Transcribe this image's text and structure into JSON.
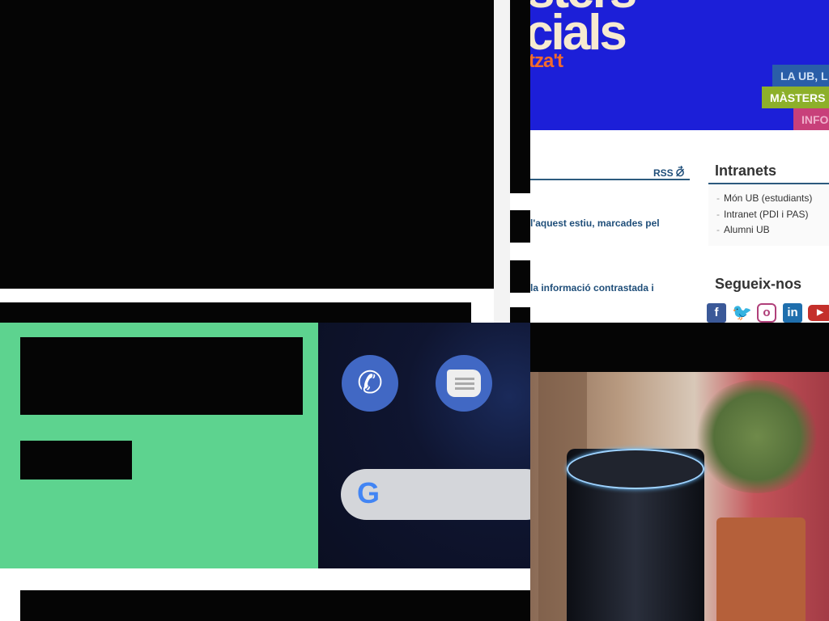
{
  "banner": {
    "title_line": "cials",
    "tagline": "tza't",
    "tabs": [
      {
        "label": "LA UB, L",
        "color": "#2a5ea8"
      },
      {
        "label": "MÀSTERS",
        "color": "#8db02a"
      },
      {
        "label": "INFO",
        "color": "#c8407a"
      }
    ]
  },
  "news": {
    "rss_label": "RSS",
    "items": [
      "l'aquest estiu, marcades pel",
      "la informació contrastada i"
    ]
  },
  "intranets": {
    "title": "Intranets",
    "items": [
      "Món UB (estudiants)",
      "Intranet (PDI i PAS)",
      "Alumni UB"
    ]
  },
  "social": {
    "title": "Segueix-nos",
    "icons": [
      "facebook-icon",
      "twitter-icon",
      "instagram-icon",
      "linkedin-icon",
      "youtube-icon"
    ]
  },
  "colors": {
    "green_panel": "#5dd38f",
    "banner_blue": "#1c1fd8",
    "phone_bg": "#0f1530"
  }
}
